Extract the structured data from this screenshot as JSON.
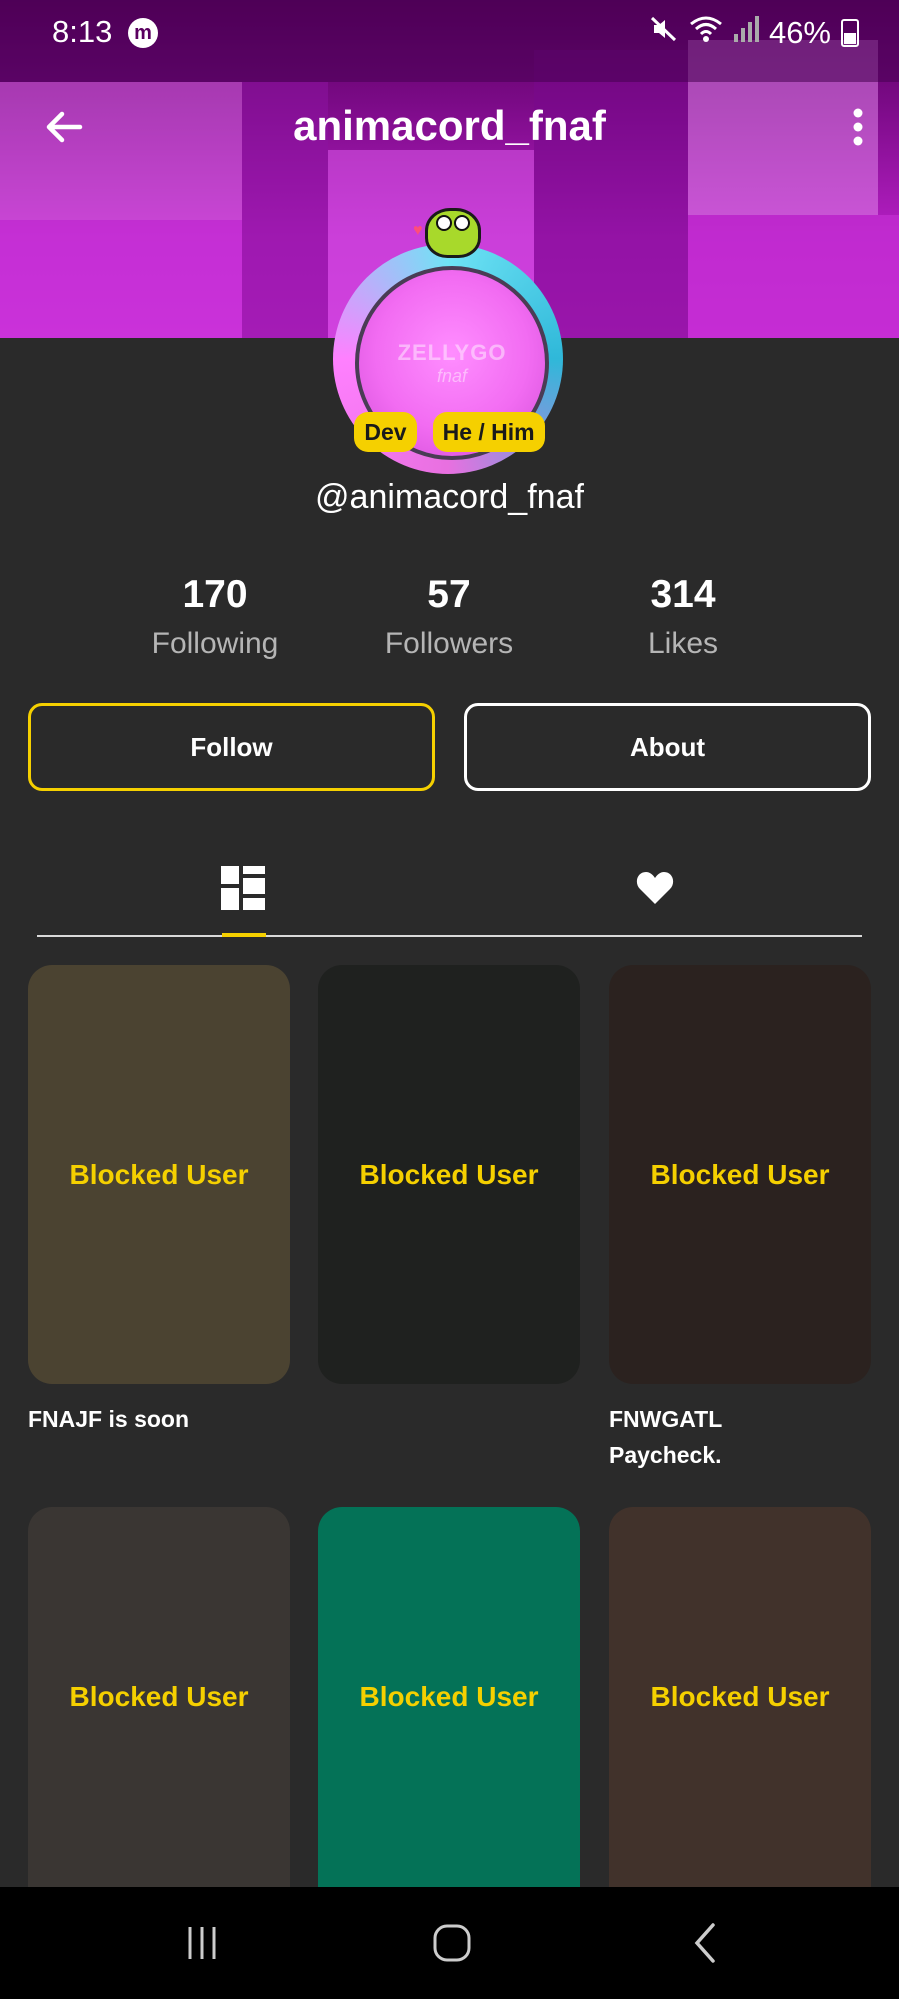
{
  "status_bar": {
    "time": "8:13",
    "app_icon": "m",
    "battery": "46%"
  },
  "header": {
    "title": "animacord_fnaf"
  },
  "avatar": {
    "text_line1": "ZELLYGO",
    "text_line2": "fnaf"
  },
  "badges": [
    "Dev",
    "He / Him"
  ],
  "profile": {
    "handle": "@animacord_fnaf"
  },
  "stats": [
    {
      "value": "170",
      "label": "Following"
    },
    {
      "value": "57",
      "label": "Followers"
    },
    {
      "value": "314",
      "label": "Likes"
    }
  ],
  "actions": {
    "follow_label": "Follow",
    "about_label": "About"
  },
  "tabs": {
    "posts_icon": "grid-icon",
    "likes_icon": "heart-icon"
  },
  "posts": [
    {
      "overlay": "Blocked User",
      "caption": "FNAJF is soon",
      "color": "#4b4331"
    },
    {
      "overlay": "Blocked User",
      "caption": "",
      "color": "#1f211f"
    },
    {
      "overlay": "Blocked User",
      "caption": "FNWGATL Paycheck.",
      "color": "#2b221f"
    },
    {
      "overlay": "Blocked User",
      "caption": "",
      "color": "#3a3633"
    },
    {
      "overlay": "Blocked User",
      "caption": "",
      "color": "#047257"
    },
    {
      "overlay": "Blocked User",
      "caption": "",
      "color": "#41322b"
    }
  ],
  "colors": {
    "accent": "#f5d000",
    "background": "#2a2a2a",
    "banner": "#b51fc4"
  }
}
